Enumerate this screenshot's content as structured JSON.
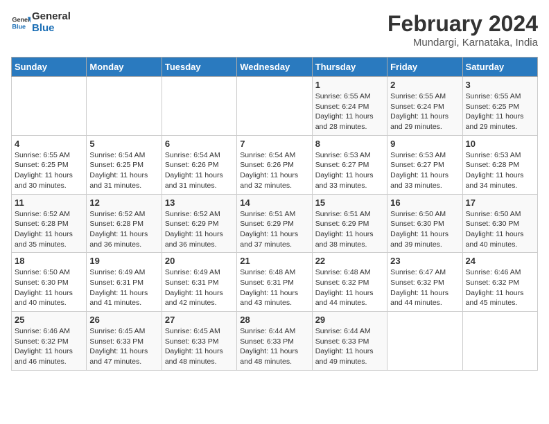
{
  "logo": {
    "text_general": "General",
    "text_blue": "Blue"
  },
  "header": {
    "month_year": "February 2024",
    "location": "Mundargi, Karnataka, India"
  },
  "days_of_week": [
    "Sunday",
    "Monday",
    "Tuesday",
    "Wednesday",
    "Thursday",
    "Friday",
    "Saturday"
  ],
  "weeks": [
    [
      {
        "day": "",
        "info": ""
      },
      {
        "day": "",
        "info": ""
      },
      {
        "day": "",
        "info": ""
      },
      {
        "day": "",
        "info": ""
      },
      {
        "day": "1",
        "info": "Sunrise: 6:55 AM\nSunset: 6:24 PM\nDaylight: 11 hours and 28 minutes."
      },
      {
        "day": "2",
        "info": "Sunrise: 6:55 AM\nSunset: 6:24 PM\nDaylight: 11 hours and 29 minutes."
      },
      {
        "day": "3",
        "info": "Sunrise: 6:55 AM\nSunset: 6:25 PM\nDaylight: 11 hours and 29 minutes."
      }
    ],
    [
      {
        "day": "4",
        "info": "Sunrise: 6:55 AM\nSunset: 6:25 PM\nDaylight: 11 hours and 30 minutes."
      },
      {
        "day": "5",
        "info": "Sunrise: 6:54 AM\nSunset: 6:25 PM\nDaylight: 11 hours and 31 minutes."
      },
      {
        "day": "6",
        "info": "Sunrise: 6:54 AM\nSunset: 6:26 PM\nDaylight: 11 hours and 31 minutes."
      },
      {
        "day": "7",
        "info": "Sunrise: 6:54 AM\nSunset: 6:26 PM\nDaylight: 11 hours and 32 minutes."
      },
      {
        "day": "8",
        "info": "Sunrise: 6:53 AM\nSunset: 6:27 PM\nDaylight: 11 hours and 33 minutes."
      },
      {
        "day": "9",
        "info": "Sunrise: 6:53 AM\nSunset: 6:27 PM\nDaylight: 11 hours and 33 minutes."
      },
      {
        "day": "10",
        "info": "Sunrise: 6:53 AM\nSunset: 6:28 PM\nDaylight: 11 hours and 34 minutes."
      }
    ],
    [
      {
        "day": "11",
        "info": "Sunrise: 6:52 AM\nSunset: 6:28 PM\nDaylight: 11 hours and 35 minutes."
      },
      {
        "day": "12",
        "info": "Sunrise: 6:52 AM\nSunset: 6:28 PM\nDaylight: 11 hours and 36 minutes."
      },
      {
        "day": "13",
        "info": "Sunrise: 6:52 AM\nSunset: 6:29 PM\nDaylight: 11 hours and 36 minutes."
      },
      {
        "day": "14",
        "info": "Sunrise: 6:51 AM\nSunset: 6:29 PM\nDaylight: 11 hours and 37 minutes."
      },
      {
        "day": "15",
        "info": "Sunrise: 6:51 AM\nSunset: 6:29 PM\nDaylight: 11 hours and 38 minutes."
      },
      {
        "day": "16",
        "info": "Sunrise: 6:50 AM\nSunset: 6:30 PM\nDaylight: 11 hours and 39 minutes."
      },
      {
        "day": "17",
        "info": "Sunrise: 6:50 AM\nSunset: 6:30 PM\nDaylight: 11 hours and 40 minutes."
      }
    ],
    [
      {
        "day": "18",
        "info": "Sunrise: 6:50 AM\nSunset: 6:30 PM\nDaylight: 11 hours and 40 minutes."
      },
      {
        "day": "19",
        "info": "Sunrise: 6:49 AM\nSunset: 6:31 PM\nDaylight: 11 hours and 41 minutes."
      },
      {
        "day": "20",
        "info": "Sunrise: 6:49 AM\nSunset: 6:31 PM\nDaylight: 11 hours and 42 minutes."
      },
      {
        "day": "21",
        "info": "Sunrise: 6:48 AM\nSunset: 6:31 PM\nDaylight: 11 hours and 43 minutes."
      },
      {
        "day": "22",
        "info": "Sunrise: 6:48 AM\nSunset: 6:32 PM\nDaylight: 11 hours and 44 minutes."
      },
      {
        "day": "23",
        "info": "Sunrise: 6:47 AM\nSunset: 6:32 PM\nDaylight: 11 hours and 44 minutes."
      },
      {
        "day": "24",
        "info": "Sunrise: 6:46 AM\nSunset: 6:32 PM\nDaylight: 11 hours and 45 minutes."
      }
    ],
    [
      {
        "day": "25",
        "info": "Sunrise: 6:46 AM\nSunset: 6:32 PM\nDaylight: 11 hours and 46 minutes."
      },
      {
        "day": "26",
        "info": "Sunrise: 6:45 AM\nSunset: 6:33 PM\nDaylight: 11 hours and 47 minutes."
      },
      {
        "day": "27",
        "info": "Sunrise: 6:45 AM\nSunset: 6:33 PM\nDaylight: 11 hours and 48 minutes."
      },
      {
        "day": "28",
        "info": "Sunrise: 6:44 AM\nSunset: 6:33 PM\nDaylight: 11 hours and 48 minutes."
      },
      {
        "day": "29",
        "info": "Sunrise: 6:44 AM\nSunset: 6:33 PM\nDaylight: 11 hours and 49 minutes."
      },
      {
        "day": "",
        "info": ""
      },
      {
        "day": "",
        "info": ""
      }
    ]
  ]
}
